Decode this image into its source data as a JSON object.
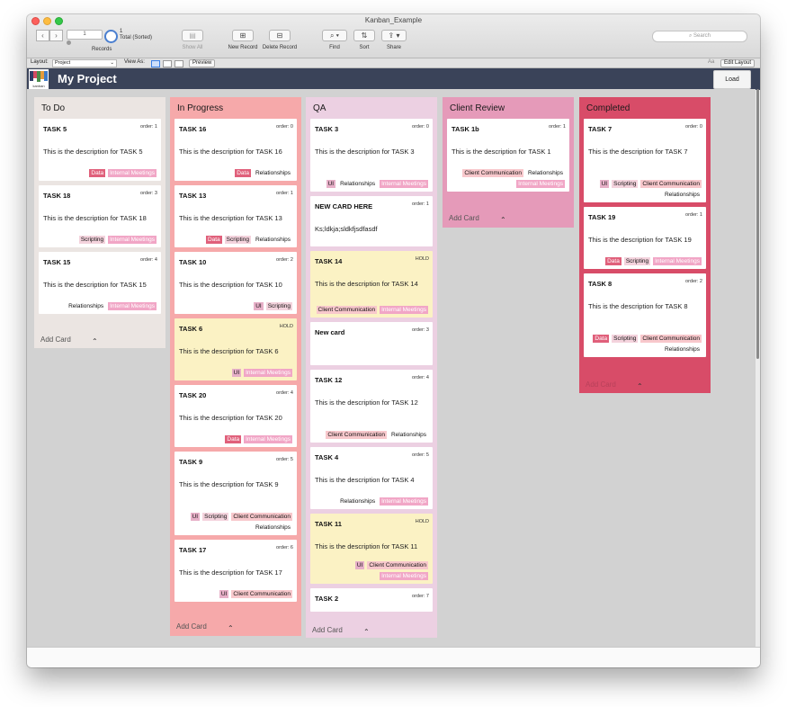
{
  "window": {
    "title": "Kanban_Example",
    "records": {
      "slider_value": "1",
      "count": "1",
      "status": "Total (Sorted)",
      "label": "Records"
    },
    "toolbar": {
      "show_all": "Show All",
      "new_record": "New Record",
      "delete_record": "Delete Record",
      "find": "Find",
      "sort": "Sort",
      "share": "Share",
      "search_placeholder": "Search"
    },
    "layoutbar": {
      "layout_label": "Layout:",
      "layout_value": "Project",
      "view_as_label": "View As:",
      "preview": "Preview",
      "edit_layout": "Edit Layout",
      "font_icon": "Aa"
    },
    "nav": {
      "back_icon": "chevron-left-icon",
      "forward_icon": "chevron-right-icon"
    }
  },
  "header": {
    "logo_caption": "kanban",
    "title": "My Project",
    "load_button": "Load",
    "bg_color": "#3a4359"
  },
  "colors": {
    "todo": "#ebe5e2",
    "in_progress": "#f6a9aa",
    "qa": "#ecd0e2",
    "client_review": "#e59ab9",
    "completed": "#d84c68",
    "hold_card": "#fbf2c4"
  },
  "board": {
    "add_card_label": "Add Card",
    "columns": [
      {
        "title": "To Do",
        "cards": [
          {
            "title": "TASK 5",
            "order": "order: 1",
            "description": "This is the description for TASK 5",
            "tags": [
              "Data",
              "Internal Meetings"
            ]
          },
          {
            "title": "TASK 18",
            "order": "order: 3",
            "description": "This is the description for TASK 18",
            "tags": [
              "Scripting",
              "Internal Meetings"
            ]
          },
          {
            "title": "TASK 15",
            "order": "order: 4",
            "description": "This is the description for TASK 15",
            "tags": [
              "Relationships",
              "Internal Meetings"
            ]
          }
        ]
      },
      {
        "title": "In Progress",
        "cards": [
          {
            "title": "TASK 16",
            "order": "order: 0",
            "description": "This is the description for TASK 16",
            "tags": [
              "Data",
              "Relationships"
            ]
          },
          {
            "title": "TASK 13",
            "order": "order: 1",
            "description": "This is the description for TASK 13",
            "tags": [
              "Data",
              "Scripting",
              "Relationships"
            ]
          },
          {
            "title": "TASK 10",
            "order": "order: 2",
            "description": "This is the description for TASK 10",
            "tags": [
              "UI",
              "Scripting"
            ]
          },
          {
            "title": "TASK 6",
            "order": "HOLD",
            "hold": true,
            "description": "This is the description for TASK 6",
            "tags": [
              "UI",
              "Internal Meetings"
            ]
          },
          {
            "title": "TASK 20",
            "order": "order: 4",
            "description": "This is the description for TASK 20",
            "tags": [
              "Data",
              "Internal Meetings"
            ]
          },
          {
            "title": "TASK 9",
            "order": "order: 5",
            "description": "This is the description for TASK 9",
            "tags": [
              "UI",
              "Scripting",
              "Client Communication",
              "Relationships"
            ]
          },
          {
            "title": "TASK 17",
            "order": "order: 6",
            "description": "This is the description for TASK 17",
            "tags": [
              "UI",
              "Client Communication"
            ]
          }
        ]
      },
      {
        "title": "QA",
        "cards": [
          {
            "title": "TASK 3",
            "order": "order: 0",
            "description": "This is the description for TASK 3",
            "tags": [
              "UI",
              "Relationships",
              "Internal Meetings"
            ]
          },
          {
            "title": "NEW CARD HERE",
            "order": "order: 1",
            "description": "Ks;ldkja;sldkfjsdfasdf",
            "tags": []
          },
          {
            "title": "TASK 14",
            "order": "HOLD",
            "hold": true,
            "description": "This is the description for TASK 14",
            "tags": [
              "Client Communication",
              "Internal Meetings"
            ]
          },
          {
            "title": "New card",
            "order": "order: 3",
            "description": "",
            "tags": []
          },
          {
            "title": "TASK 12",
            "order": "order: 4",
            "description": "This is the description for TASK 12",
            "tags": [
              "Client Communication",
              "Relationships"
            ]
          },
          {
            "title": "TASK 4",
            "order": "order: 5",
            "description": "This is the description for TASK 4",
            "tags": [
              "Relationships",
              "Internal Meetings"
            ]
          },
          {
            "title": "TASK 11",
            "order": "HOLD",
            "hold": true,
            "description": "This is the description for TASK 11",
            "tags": [
              "UI",
              "Client Communication",
              "Internal Meetings"
            ]
          },
          {
            "title": "TASK 2",
            "order": "order: 7",
            "description": "",
            "tags": []
          }
        ]
      },
      {
        "title": "Client Review",
        "cards": [
          {
            "title": "TASK 1b",
            "order": "order: 1",
            "description": "This is the description for TASK 1",
            "tags": [
              "Client Communication",
              "Relationships",
              "Internal Meetings"
            ]
          }
        ]
      },
      {
        "title": "Completed",
        "cards": [
          {
            "title": "TASK 7",
            "order": "order: 0",
            "description": "This is the description for TASK 7",
            "tags": [
              "UI",
              "Scripting",
              "Client Communication",
              "Relationships"
            ]
          },
          {
            "title": "TASK 19",
            "order": "order: 1",
            "description": "This is the description for TASK 19",
            "tags": [
              "Data",
              "Scripting",
              "Internal Meetings"
            ]
          },
          {
            "title": "TASK 8",
            "order": "order: 2",
            "description": "This is the description for TASK 8",
            "tags": [
              "Data",
              "Scripting",
              "Client Communication",
              "Relationships"
            ]
          }
        ]
      }
    ]
  }
}
